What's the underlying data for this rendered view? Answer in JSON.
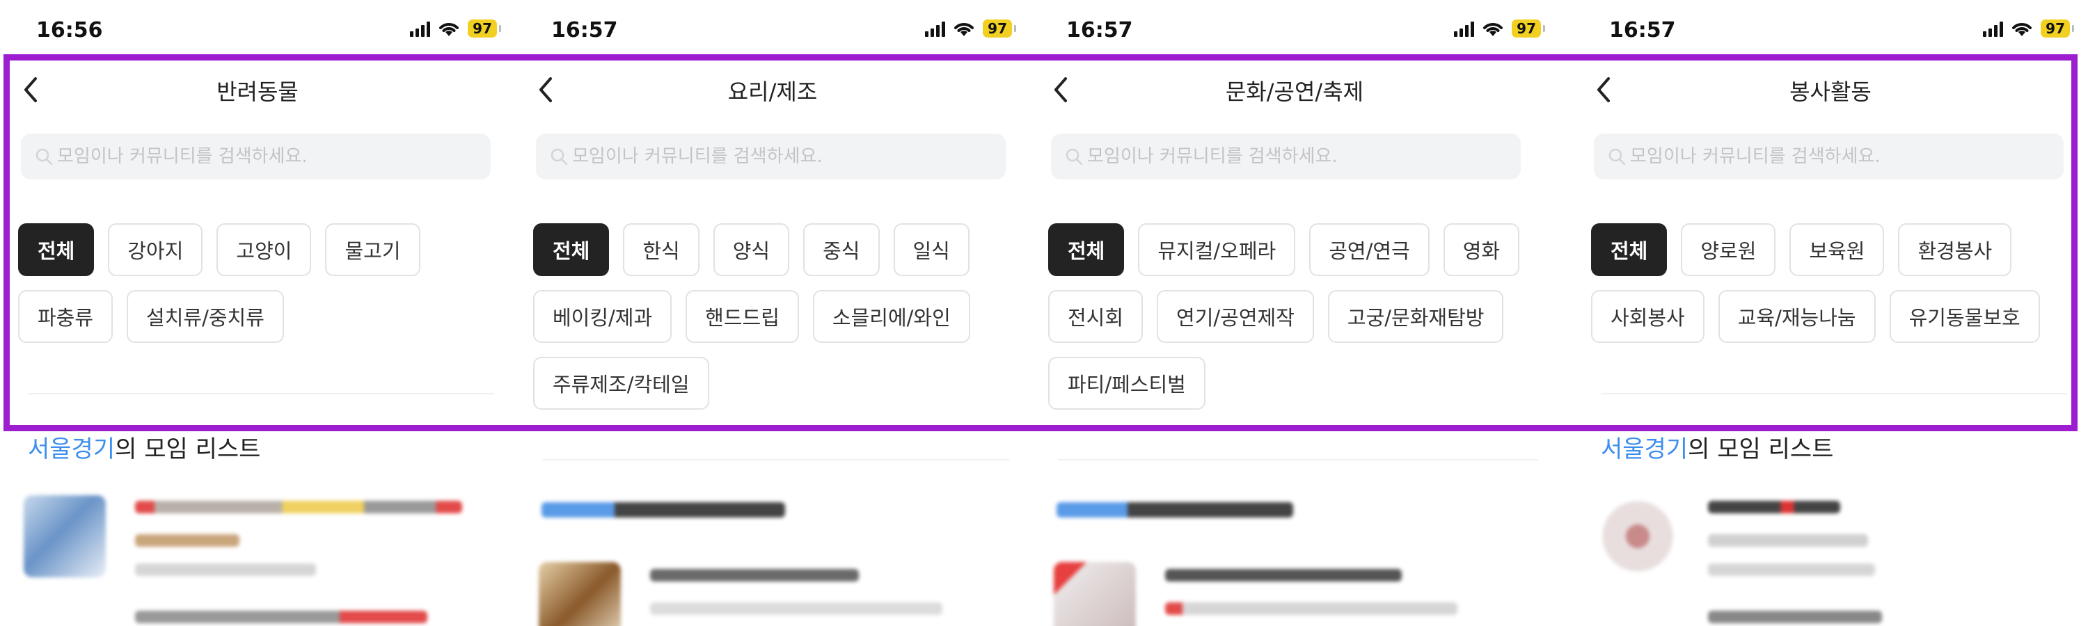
{
  "frame_color": "#9d1ed0",
  "screens": [
    {
      "status": {
        "time": "16:56",
        "battery": "97"
      },
      "header": {
        "title": "반려동물"
      },
      "search": {
        "placeholder": "모임이나 커뮤니티를 검색하세요."
      },
      "chips": [
        "전체",
        "강아지",
        "고양이",
        "물고기",
        "파충류",
        "설치류/중치류"
      ],
      "list": {
        "place": "서울경기",
        "suffix": "의 모임 리스트"
      }
    },
    {
      "status": {
        "time": "16:57",
        "battery": "97"
      },
      "header": {
        "title": "요리/제조"
      },
      "search": {
        "placeholder": "모임이나 커뮤니티를 검색하세요."
      },
      "chips": [
        "전체",
        "한식",
        "양식",
        "중식",
        "일식",
        "베이킹/제과",
        "핸드드립",
        "소믈리에/와인",
        "주류제조/칵테일"
      ]
    },
    {
      "status": {
        "time": "16:57",
        "battery": "97"
      },
      "header": {
        "title": "문화/공연/축제"
      },
      "search": {
        "placeholder": "모임이나 커뮤니티를 검색하세요."
      },
      "chips": [
        "전체",
        "뮤지컬/오페라",
        "공연/연극",
        "영화",
        "전시회",
        "연기/공연제작",
        "고궁/문화재탐방",
        "파티/페스티벌"
      ]
    },
    {
      "status": {
        "time": "16:57",
        "battery": "97"
      },
      "header": {
        "title": "봉사활동"
      },
      "search": {
        "placeholder": "모임이나 커뮤니티를 검색하세요."
      },
      "chips": [
        "전체",
        "양로원",
        "보육원",
        "환경봉사",
        "사회봉사",
        "교육/재능나눔",
        "유기동물보호"
      ],
      "list": {
        "place": "서울경기",
        "suffix": "의 모임 리스트"
      }
    }
  ]
}
